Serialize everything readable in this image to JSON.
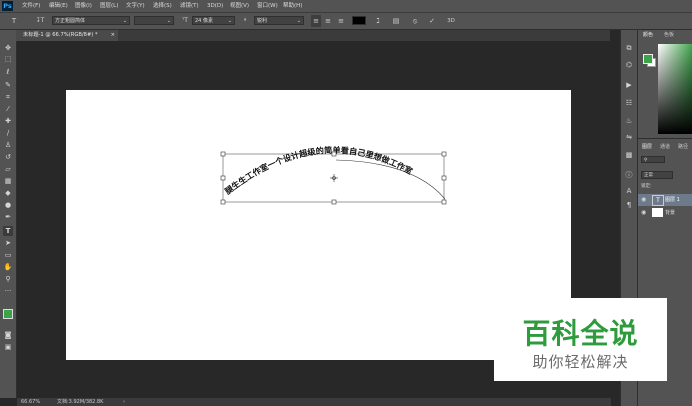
{
  "app": {
    "logo": "Ps"
  },
  "menu": [
    "文件(F)",
    "编辑(E)",
    "图像(I)",
    "图层(L)",
    "文字(Y)",
    "选择(S)",
    "滤镜(T)",
    "3D(D)",
    "视图(V)",
    "窗口(W)",
    "帮助(H)"
  ],
  "options": {
    "font_family": "方正粗圆简体",
    "font_size": "24 像素",
    "aa_label": "ª",
    "aa_mode": "锐利",
    "color_swatch": "#000000"
  },
  "document": {
    "tab_label": "未标题-1 @ 66.7%(RGB/8#) *",
    "close": "×",
    "warped_text": "腿生生工作室一个设计超级的简单看自己里想做工作室",
    "background": "#ffffff"
  },
  "tools": [
    "move-icon",
    "marquee-icon",
    "lasso-icon",
    "quick-select-icon",
    "crop-icon",
    "eyedropper-icon",
    "healing-icon",
    "brush-icon",
    "stamp-icon",
    "history-brush-icon",
    "eraser-icon",
    "gradient-icon",
    "blur-icon",
    "dodge-icon",
    "pen-icon",
    "type-icon",
    "path-select-icon",
    "shape-icon",
    "hand-icon",
    "zoom-icon",
    "more-icon"
  ],
  "type_tool_label": "T",
  "status": {
    "zoom": "66.67%",
    "doc": "文档:3.92M/382.8K"
  },
  "panels": {
    "color_tab": "颜色",
    "swatch_tab": "色板",
    "layers_tab": "图层",
    "channels_tab": "通道",
    "paths_tab": "路径",
    "blend_mode": "正常",
    "lock_label": "锁定:",
    "layers": [
      {
        "name": "图层 1",
        "thumb": "T"
      },
      {
        "name": "背景",
        "thumb": ""
      }
    ],
    "fg_color": "#3da34a",
    "bg_color": "#ffffff"
  },
  "watermark": {
    "title": "百科全说",
    "subtitle": "助你轻松解决"
  }
}
